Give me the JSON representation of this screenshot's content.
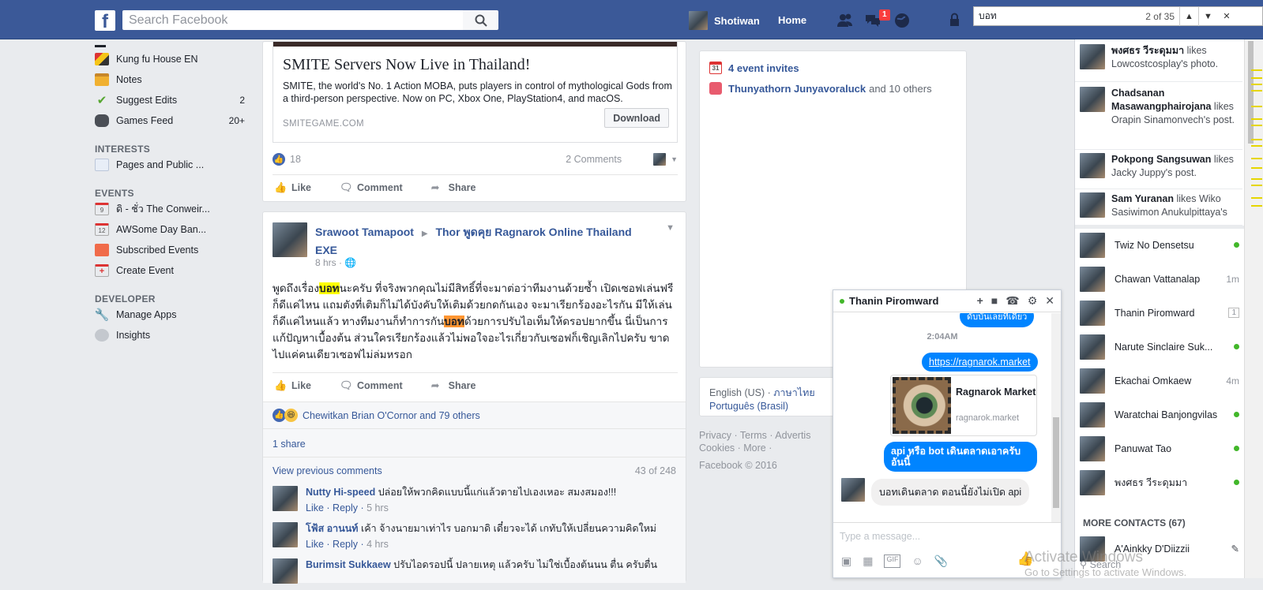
{
  "topbar": {
    "logo": "f",
    "search_placeholder": "Search Facebook",
    "profile_name": "Shotiwan",
    "home_label": "Home",
    "notification_badge": "1",
    "brand_color": "#3b5998"
  },
  "find_bar": {
    "query": "บอท",
    "count": "2 of 35"
  },
  "left_nav": {
    "items": [
      {
        "label": "Kung fu House EN",
        "icon": "kungfu-icon",
        "count": ""
      },
      {
        "label": "Notes",
        "icon": "notes-icon",
        "count": ""
      },
      {
        "label": "Suggest Edits",
        "icon": "check-icon",
        "count": "2"
      },
      {
        "label": "Games Feed",
        "icon": "gamepad-icon",
        "count": "20+"
      }
    ],
    "interests_heading": "INTERESTS",
    "interests": [
      {
        "label": "Pages and Public ..."
      }
    ],
    "events_heading": "EVENTS",
    "events": [
      {
        "label": "ดิ - ชั่ว The Conweir...",
        "icon_text": "9"
      },
      {
        "label": "AWSome Day Ban...",
        "icon_text": "12"
      },
      {
        "label": "Subscribed Events",
        "icon_text": ""
      },
      {
        "label": "Create Event",
        "icon_text": "+"
      }
    ],
    "developer_heading": "DEVELOPER",
    "developer": [
      {
        "label": "Manage Apps"
      },
      {
        "label": "Insights"
      }
    ]
  },
  "ad_post": {
    "title": "SMITE Servers Now Live in Thailand!",
    "description": "SMITE, the world's No. 1 Action MOBA, puts players in control of mythological Gods from a third-person perspective. Now on PC, Xbox One, PlayStation4, and macOS.",
    "domain": "SMITEGAME.COM",
    "cta": "Download",
    "likes": "18",
    "comments": "2 Comments",
    "actions": {
      "like": "Like",
      "comment": "Comment",
      "share": "Share"
    }
  },
  "post": {
    "author": "Srawoot Tamapoot",
    "target": "Thor พูดคุย Ragnarok Online Thailand EXE",
    "time": "8 hrs",
    "body_parts": {
      "p1": "พูดถึงเรื่อง",
      "hl1": "บอท",
      "p2": "นะครับ ที่จริงพวกคุณไม่มีสิทธิ์ที่จะมาต่อว่าทีมงานด้วยซ้ำ เปิดเซอฟเล่นฟรีก็ดีแค่ไหน แถมตังที่เติมก็ไม่ได้บังคับให้เติมด้วยกดกันเอง จะมาเรียกร้องอะไรกัน มีให้เล่นก็ดีแค่ไหนแล้ว ทางทีมงานก็ทำการกัน",
      "hl2": "บอท",
      "p3": "ด้วยการปรับไอเท็มให้ดรอปยากขึ้น นี่เป็นการแก้ปัญหาเบื้องต้น ส่วนใครเรียกร้องแล้วไม่พอใจอะไรเกี่ยวกับเซอฟก็เชิญเลิกไปครับ ขาดไปแค่คนเดียวเซอฟไม่ล่มหรอก"
    },
    "actions": {
      "like": "Like",
      "comment": "Comment",
      "share": "Share"
    },
    "reactions_text": "Chewitkan Brian O'Cornor and 79 others",
    "shares": "1 share",
    "view_previous": "View previous comments",
    "comment_count": "43 of 248",
    "comments": [
      {
        "name": "Nutty Hi-speed",
        "text": "ปล่อยให้พวกคิดแบบนี้แก่แล้วตายไปเองเหอะ สมงสมอง!!!",
        "like": "Like",
        "reply": "Reply",
        "time": "5 hrs"
      },
      {
        "name": "โฟ้ส อานนท์",
        "text": "เค้า จ้างนายมาเท่าไร บอกมาดิ เดี๋ยวจะได้ เกทับให้เปลี่ยนความคิดใหม่",
        "like": "Like",
        "reply": "Reply",
        "time": "4 hrs"
      },
      {
        "name": "Burimsit Sukkaew",
        "text": "ปรับไอดรอปนี้ ปลายเหตุ แล้วครับ ไม่ใช่เบื้องต้นนน ตื่น ครับตื่น",
        "like": "",
        "reply": "",
        "time": ""
      }
    ]
  },
  "right_col": {
    "event_invites": "4 event invites",
    "birthday_name": "Thunyathorn Junyavoraluck",
    "birthday_rest": "and 10 others",
    "lang_current": "English (US)",
    "lang_thai": "ภาษาไทย",
    "lang_pt": "Português (Brasil)",
    "footer_line1": "Privacy · Terms · Advertis",
    "footer_line2": "Cookies · More ·",
    "footer_line3": "Facebook © 2016"
  },
  "chat": {
    "name": "Thanin Piromward",
    "top_partial": "ดับบันเลยทีเดียว",
    "time": "2:04AM",
    "link": "https://ragnarok.market",
    "preview_title": "Ragnarok Market",
    "preview_domain": "ragnarok.market",
    "sent_msg": "api หรือ bot เดินตลาดเอาครับ อันนี้",
    "reply_msg": "บอทเดินตลาด ตอนนี้ยังไม่เปิด api",
    "input_placeholder": "Type a message..."
  },
  "ticker": [
    {
      "name": "พงศธร วีระดุมมา",
      "text": "likes Lowcostcosplay's photo."
    },
    {
      "name": "Chadsanan Masawangphairojana",
      "text": "likes Orapin Sinamonvech's post."
    },
    {
      "name": "Pokpong Sangsuwan",
      "text": "likes Jacky Juppy's post."
    },
    {
      "name": "Sam Yuranan",
      "text": "likes Wiko Sasiwimon Anukulpittaya's"
    }
  ],
  "contacts": [
    {
      "name": "Twiz No Densetsu",
      "status": "online"
    },
    {
      "name": "Chawan Vattanalap",
      "status": "1m"
    },
    {
      "name": "Thanin Piromward",
      "status": "1"
    },
    {
      "name": "Narute Sinclaire Suk...",
      "status": "online"
    },
    {
      "name": "Ekachai Omkaew",
      "status": "4m"
    },
    {
      "name": "Waratchai Banjongvilas",
      "status": "online"
    },
    {
      "name": "Panuwat Tao",
      "status": "online"
    },
    {
      "name": "พงศธร วีระดุมมา",
      "status": "online"
    }
  ],
  "more_contacts": "MORE CONTACTS (67)",
  "partial_contact": "A'Ainkky D'Diizzii",
  "sidebar_search": "Search",
  "watermark": {
    "line1": "Activate Windows",
    "line2": "Go to Settings to activate Windows."
  }
}
